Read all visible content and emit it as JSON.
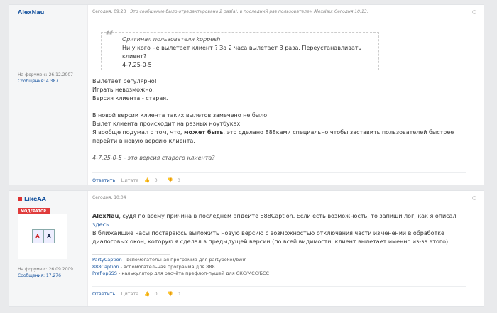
{
  "post1": {
    "username": "AlexNau",
    "timestamp": "Сегодня, 09:23",
    "edit_note": "Это сообщение было отредактировано 2 раз(а), в последний раз пользователем AlexNau: Сегодня 10:13.",
    "member_since": "На форуме с: 26.12.2007",
    "post_count": "Сообщения: 4.387",
    "quote": {
      "header": "Оригинал пользователя koppesh",
      "line1": "Ни у кого не вылетает клиент ? За 2 часа вылетает 3 раза. Переустанавливать клиент?",
      "line2": "4-7.25-0-5"
    },
    "lines": [
      "Вылетает регулярно!",
      "Играть невозможно.",
      "Версия клиента - старая."
    ],
    "para2_l1": "В новой версии клиента таких вылетов замечено не было.",
    "para2_l2": "Вылет клиента происходит на разных ноутбуках.",
    "para2_l3_pre": "Я вообще подумал о том, что, ",
    "para2_l3_bold": "может быть",
    "para2_l3_post": ", это сделано 888ками специально чтобы заставить пользователей быстрее",
    "para2_l4": "перейти в новую версию клиента.",
    "italic_note": "4-7.25-0-5 - это версия старого клиента?",
    "footer": {
      "reply": "Ответить",
      "quote": "Цитата",
      "likes": "0",
      "dislikes": "0"
    }
  },
  "post2": {
    "username": "LikeAA",
    "badge": "МОДЕРАТОР",
    "timestamp": "Сегодня, 10:04",
    "member_since": "На форуме с: 26.09.2009",
    "post_count": "Сообщения: 17.276",
    "avatar_cards": [
      "A",
      "A"
    ],
    "mention": "AlexNau",
    "text1_post": ", судя по всему причина в последнем апдейте 888Caption. Если есть возможность, то запиши лог, как я описал",
    "here_link": "здесь",
    "text1_end": ".",
    "text2": "В ближайшие часы постараюсь выложить новую версию с возможностью отключения части изменений в обработке",
    "text3": "диалоговых окон, которую я сделал в предыдущей версии (по всей видимости, клиент вылетает именно из-за этого).",
    "links": [
      {
        "name": "PartyCaption",
        "desc": " - вспомогательная программа для partypoker/bwin"
      },
      {
        "name": "888Caption",
        "desc": " - вспомогательная программа для 888"
      },
      {
        "name": "PreflopSSS",
        "desc": " - калькулятор для расчёта префлоп-пушей для СКС/МСС/БСС"
      }
    ],
    "footer": {
      "reply": "Ответить",
      "quote": "Цитата",
      "likes": "0",
      "dislikes": "0"
    }
  }
}
